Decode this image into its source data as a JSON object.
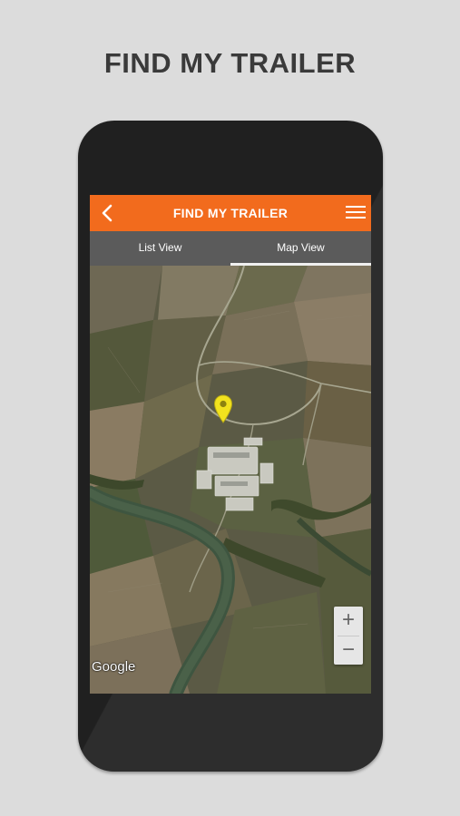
{
  "promo": {
    "headline": "FIND MY TRAILER"
  },
  "appbar": {
    "title": "FIND MY TRAILER",
    "back_icon": "chevron-left-icon",
    "menu_icon": "hamburger-menu-icon",
    "color": "#f26b1d"
  },
  "tabs": [
    {
      "label": "List View",
      "active": false
    },
    {
      "label": "Map View",
      "active": true
    }
  ],
  "map": {
    "type": "satellite",
    "marker_icon": "yellow-location-pin-icon",
    "marker_color": "#f2e21e",
    "zoom_in_label": "+",
    "zoom_out_label": "−",
    "attribution": "Google"
  }
}
